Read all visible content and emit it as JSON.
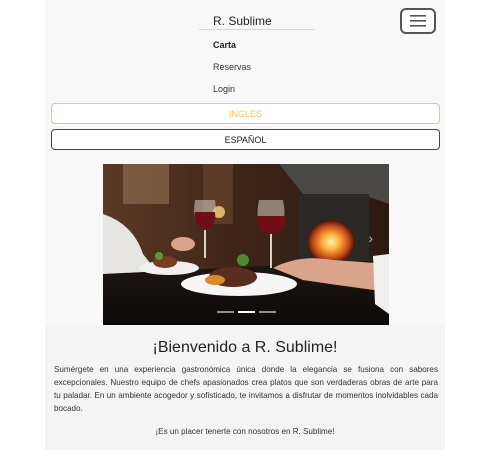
{
  "navbar": {
    "brand": "R. Sublime",
    "links": [
      "Carta",
      "Reservas",
      "Login"
    ],
    "toggler_icon": "hamburger-menu-icon"
  },
  "languages": {
    "english": "INGLES",
    "spanish": "ESPAÑOL"
  },
  "colors": {
    "accent": "#f3c75a",
    "dark_border": "#444444"
  },
  "carousel": {
    "slide_count": 3,
    "active_index": 1,
    "next_icon": "chevron-right-icon"
  },
  "welcome": {
    "title": "¡Bienvenido a R. Sublime!",
    "text": "Sumérgete en una experiencia gastronómica única donde la elegancia se fusiona con sabores excepcionales. Nuestro equipo de chefs apasionados crea platos que son verdaderas obras de arte para tu paladar. En un ambiente acogedor y sofisticado, te invitamos a disfrutar de momentos inolvidables cada bocado.",
    "closing": "¡Es un placer tenerte con nosotros en R. Sublime!"
  }
}
